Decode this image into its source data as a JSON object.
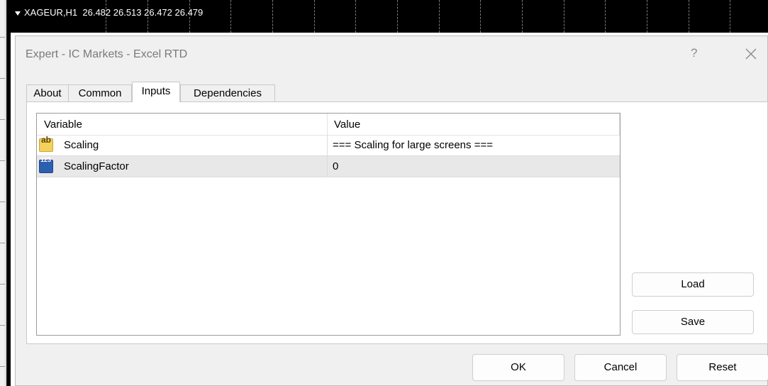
{
  "chart": {
    "symbol": "XAGEUR,H1",
    "prices": "26.482 26.513 26.472 26.479"
  },
  "dialog": {
    "title": "Expert - IC Markets - Excel RTD",
    "help_label": "?",
    "close_icon": "close-icon"
  },
  "tabs": [
    {
      "label": "About",
      "active": false
    },
    {
      "label": "Common",
      "active": false
    },
    {
      "label": "Inputs",
      "active": true
    },
    {
      "label": "Dependencies",
      "active": false
    }
  ],
  "table": {
    "columns": [
      "Variable",
      "Value"
    ],
    "rows": [
      {
        "icon": "string-type-icon",
        "icon_text": "ab",
        "variable": "Scaling",
        "value": "=== Scaling for large screens ===",
        "selected": false
      },
      {
        "icon": "number-type-icon",
        "icon_text": "123",
        "variable": "ScalingFactor",
        "value": "0",
        "selected": true
      }
    ]
  },
  "side_buttons": {
    "load": "Load",
    "save": "Save"
  },
  "footer_buttons": {
    "ok": "OK",
    "cancel": "Cancel",
    "reset": "Reset"
  },
  "colors": {
    "chart_background": "#000000",
    "dialog_background": "#f0f0f0",
    "selected_row": "#e8e8e8"
  }
}
